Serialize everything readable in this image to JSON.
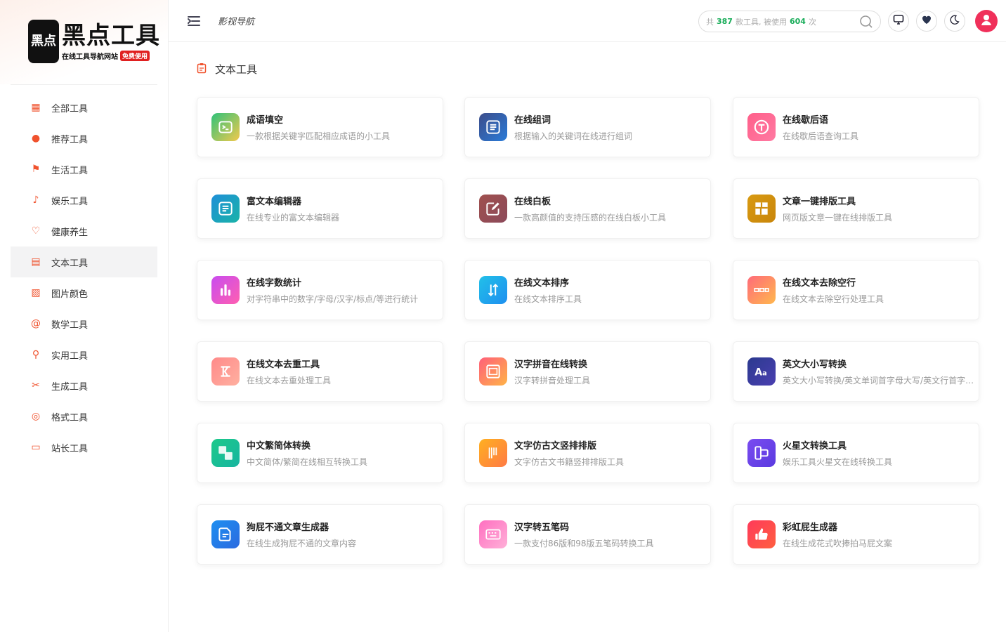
{
  "logo": {
    "box_text": "黑点",
    "title": "黑点工具",
    "sub": "在线工具导航网站",
    "badge": "免费使用"
  },
  "sidebar": {
    "items": [
      {
        "label": "全部工具",
        "icon": "grid-plus-icon",
        "glyph": "▦"
      },
      {
        "label": "推荐工具",
        "icon": "fire-icon",
        "glyph": "●"
      },
      {
        "label": "生活工具",
        "icon": "flag-icon",
        "glyph": "⚑"
      },
      {
        "label": "娱乐工具",
        "icon": "music-note-icon",
        "glyph": "♪"
      },
      {
        "label": "健康养生",
        "icon": "heart-icon",
        "glyph": "♡"
      },
      {
        "label": "文本工具",
        "icon": "clipboard-icon",
        "glyph": "▤"
      },
      {
        "label": "图片颜色",
        "icon": "image-icon",
        "glyph": "▨"
      },
      {
        "label": "数学工具",
        "icon": "at-icon",
        "glyph": "@"
      },
      {
        "label": "实用工具",
        "icon": "search-icon",
        "glyph": "⚲"
      },
      {
        "label": "生成工具",
        "icon": "tools-icon",
        "glyph": "✂"
      },
      {
        "label": "格式工具",
        "icon": "code-circle-icon",
        "glyph": "◎"
      },
      {
        "label": "站长工具",
        "icon": "monitor-icon",
        "glyph": "▭"
      }
    ],
    "active_index": 5
  },
  "header": {
    "title": "影视导航",
    "search": {
      "prefix": "共",
      "tool_count": "387",
      "middle": "款工具, 被使用",
      "use_count": "604",
      "suffix": "次"
    }
  },
  "section": {
    "title": "文本工具"
  },
  "tools": [
    {
      "title": "成语填空",
      "desc": "一款根据关键字匹配相应成语的小工具",
      "icon": "terminal-icon",
      "bg": "linear-gradient(135deg,#2fc27a,#f2c94c)"
    },
    {
      "title": "在线组词",
      "desc": "根据输入的关键词在线进行组词",
      "icon": "document-list-icon",
      "bg": "linear-gradient(135deg,#3d4d8a,#2a7bd8)"
    },
    {
      "title": "在线歇后语",
      "desc": "在线歇后语查询工具",
      "icon": "t-circle-icon",
      "bg": "linear-gradient(135deg,#ff5f8a,#ff7aa2)"
    },
    {
      "title": "富文本编辑器",
      "desc": "在线专业的富文本编辑器",
      "icon": "editor-icon",
      "bg": "linear-gradient(135deg,#1f8fd8,#1ab3a8)"
    },
    {
      "title": "在线白板",
      "desc": "一款高颜值的支持压感的在线白板小工具",
      "icon": "whiteboard-pen-icon",
      "bg": "linear-gradient(135deg,#a0504e,#8c4a5a)"
    },
    {
      "title": "文章一键排版工具",
      "desc": "网页版文章一键在线排版工具",
      "icon": "layout-icon",
      "bg": "linear-gradient(135deg,#d89a12,#c9860b)"
    },
    {
      "title": "在线字数统计",
      "desc": "对字符串中的数字/字母/汉字/标点/等进行统计",
      "icon": "bar-chart-icon",
      "bg": "linear-gradient(135deg,#c84cf0,#ff5fb0)"
    },
    {
      "title": "在线文本排序",
      "desc": "在线文本排序工具",
      "icon": "sort-arrows-icon",
      "bg": "linear-gradient(135deg,#22c0e8,#1e8ff0)"
    },
    {
      "title": "在线文本去除空行",
      "desc": "在线文本去除空行处理工具",
      "icon": "blank-lines-icon",
      "bg": "linear-gradient(135deg,#ff6a7a,#ffb84d)"
    },
    {
      "title": "在线文本去重工具",
      "desc": "在线文本去重处理工具",
      "icon": "dedupe-icon",
      "bg": "linear-gradient(135deg,#ff8a8a,#ffb0a0)"
    },
    {
      "title": "汉字拼音在线转换",
      "desc": "汉字转拼音处理工具",
      "icon": "pinyin-card-icon",
      "bg": "linear-gradient(135deg,#ff5f7a,#ffb347)"
    },
    {
      "title": "英文大小写转换",
      "desc": "英文大小写转换/英文单词首字母大写/英文行首字母大写",
      "icon": "font-case-icon",
      "bg": "linear-gradient(135deg,#2b3a8f,#4a3fb0)"
    },
    {
      "title": "中文繁简体转换",
      "desc": "中文简体/繁简在线相互转换工具",
      "icon": "simplified-traditional-icon",
      "bg": "linear-gradient(135deg,#1dc98a,#17b5a0)"
    },
    {
      "title": "文字仿古文竖排排版",
      "desc": "文字仿古文书籍竖排排版工具",
      "icon": "vertical-text-icon",
      "bg": "linear-gradient(135deg,#ffb020,#ff7a45)"
    },
    {
      "title": "火星文转换工具",
      "desc": "娱乐工具火星文在线转换工具",
      "icon": "shapes-icon",
      "bg": "linear-gradient(135deg,#7a4cf0,#5a3ae0)"
    },
    {
      "title": "狗屁不通文章生成器",
      "desc": "在线生成狗屁不通的文章内容",
      "icon": "doc-lines-icon",
      "bg": "linear-gradient(135deg,#1e8ff0,#2b6ae0)"
    },
    {
      "title": "汉字转五笔码",
      "desc": "一款支付86版和98版五笔码转换工具",
      "icon": "keyboard-icon",
      "bg": "linear-gradient(135deg,#ff6fc0,#ffb0d8)"
    },
    {
      "title": "彩虹屁生成器",
      "desc": "在线生成花式吹捧拍马屁文案",
      "icon": "thumbs-up-icon",
      "bg": "linear-gradient(135deg,#ff3a5a,#ff5f40)"
    }
  ]
}
